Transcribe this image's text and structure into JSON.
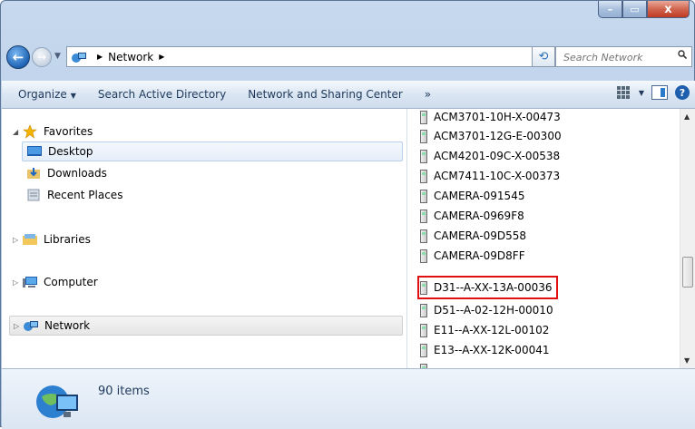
{
  "window": {
    "minimize_glyph": "–",
    "maximize_glyph": "▭",
    "close_glyph": "x"
  },
  "nav": {
    "back_glyph": "←",
    "forward_glyph": "→",
    "address_segments": [
      "Network"
    ],
    "search_placeholder": "Search Network"
  },
  "toolbar": {
    "organize": "Organize",
    "search_ad": "Search Active Directory",
    "network_center": "Network and Sharing Center",
    "overflow": "»"
  },
  "sidebar": {
    "favorites": "Favorites",
    "desktop": "Desktop",
    "downloads": "Downloads",
    "recent": "Recent Places",
    "libraries": "Libraries",
    "computer": "Computer",
    "network": "Network"
  },
  "files": [
    "ACM3701-10H-X-00473",
    "ACM3701-12G-E-00300",
    "ACM4201-09C-X-00538",
    "ACM7411-10C-X-00373",
    "CAMERA-091545",
    "CAMERA-0969F8",
    "CAMERA-09D558",
    "CAMERA-09D8FF",
    "D31--A-XX-13A-00036",
    "D51--A-02-12H-00010",
    "E11--A-XX-12L-00102",
    "E13--A-XX-12K-00041"
  ],
  "highlighted_file": "D31--A-XX-13A-00036",
  "status": {
    "item_count": "90 items"
  },
  "colors": {
    "highlight_box": "#e01010",
    "selection": "#e5eef9"
  }
}
